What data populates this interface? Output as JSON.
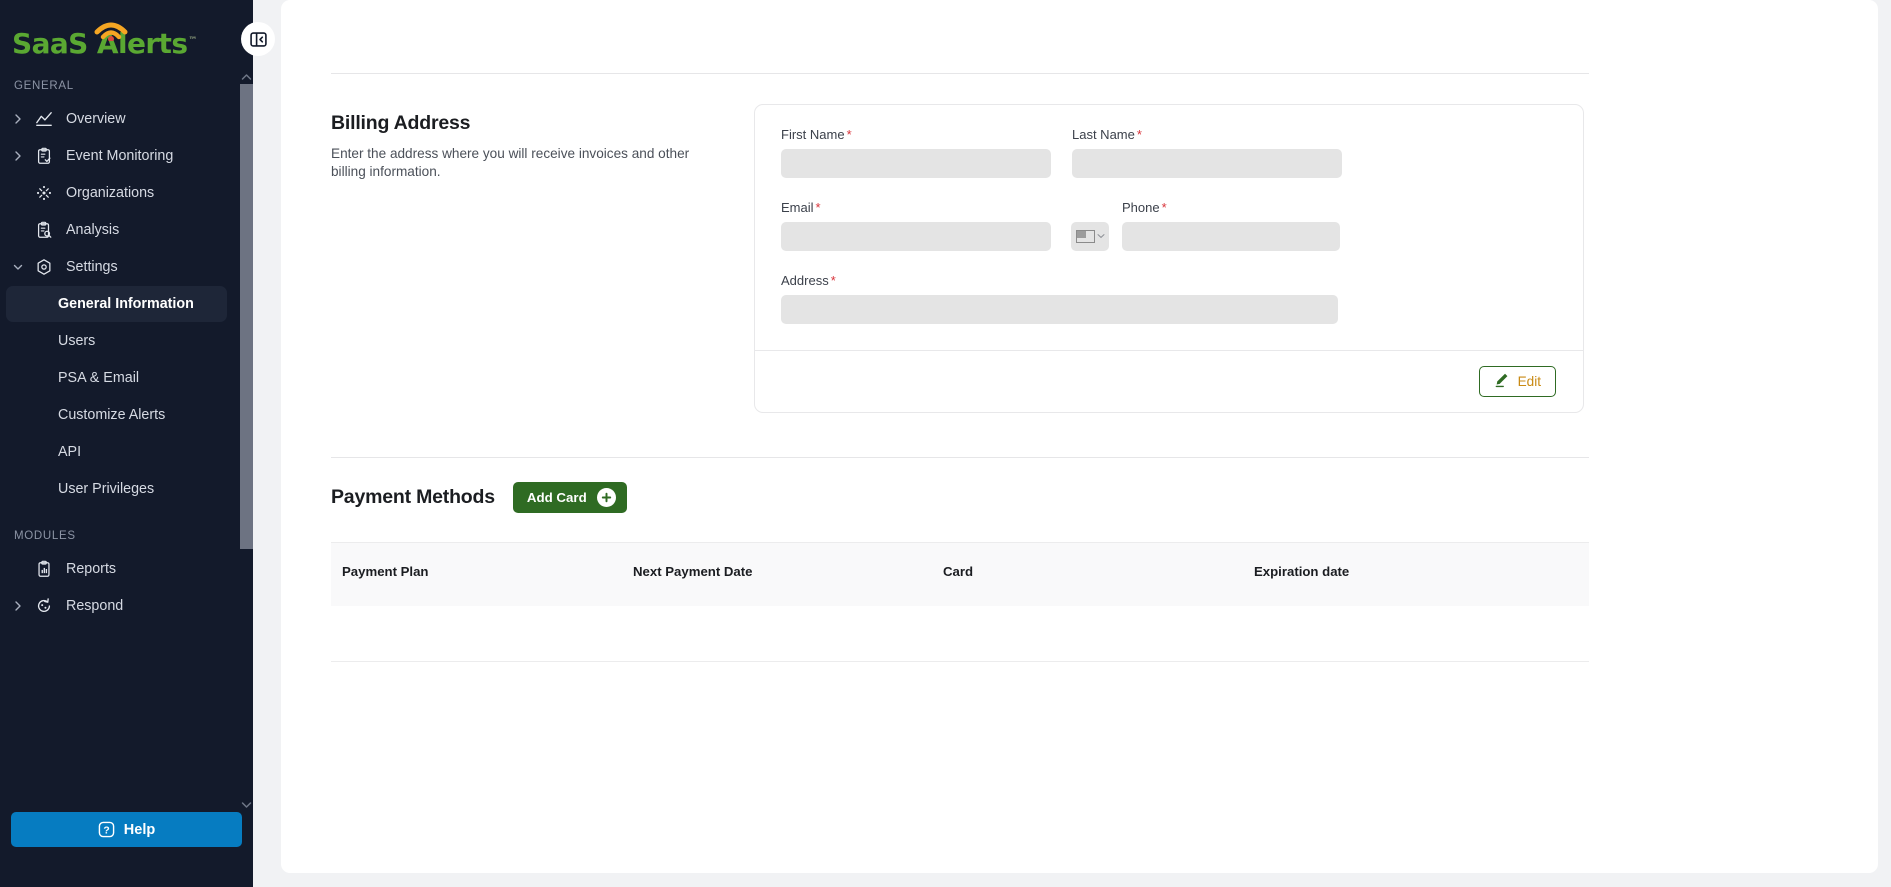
{
  "brand": {
    "name_part1": "SaaS",
    "name_part2": "Alerts",
    "trademark": "™"
  },
  "sidebar": {
    "sections": [
      {
        "label": "GENERAL"
      },
      {
        "label": "MODULES"
      }
    ],
    "general_items": [
      {
        "label": "Overview",
        "icon": "chart-line-icon",
        "chevron": true,
        "sub": false
      },
      {
        "label": "Event Monitoring",
        "icon": "clipboard-check-icon",
        "chevron": true,
        "sub": false
      },
      {
        "label": "Organizations",
        "icon": "organizations-icon",
        "chevron": false,
        "sub": false
      },
      {
        "label": "Analysis",
        "icon": "clipboard-search-icon",
        "chevron": false,
        "sub": false
      },
      {
        "label": "Settings",
        "icon": "settings-hex-icon",
        "chevron": true,
        "expanded": true,
        "sub": false
      }
    ],
    "settings_children": [
      {
        "label": "General Information",
        "active": true
      },
      {
        "label": "Users",
        "active": false
      },
      {
        "label": "PSA & Email",
        "active": false
      },
      {
        "label": "Customize Alerts",
        "active": false
      },
      {
        "label": "API",
        "active": false
      },
      {
        "label": "User Privileges",
        "active": false
      }
    ],
    "modules_items": [
      {
        "label": "Reports",
        "icon": "reports-icon",
        "chevron": false
      },
      {
        "label": "Respond",
        "icon": "respond-refresh-icon",
        "chevron": true
      }
    ],
    "help_label": "Help",
    "collapse_icon": "panel-collapse-left-icon"
  },
  "billing": {
    "title": "Billing Address",
    "description": "Enter the address where you will receive invoices and other billing information.",
    "fields": {
      "first_name": {
        "label": "First Name",
        "required": "*",
        "value": "",
        "placeholder": ""
      },
      "last_name": {
        "label": "Last Name",
        "required": "*",
        "value": "",
        "placeholder": ""
      },
      "email": {
        "label": "Email",
        "required": "*",
        "value": "",
        "placeholder": ""
      },
      "phone": {
        "label": "Phone",
        "required": "*",
        "value": "",
        "placeholder": ""
      },
      "address": {
        "label": "Address",
        "required": "*",
        "value": "",
        "placeholder": ""
      }
    },
    "country_select": {
      "icon": "us-flag-icon",
      "caret": "chevron-down-icon"
    },
    "edit_button": {
      "label": "Edit",
      "icon": "pencil-icon",
      "border_color": "#2f6b23",
      "text_color": "#c98a14"
    }
  },
  "payment_methods": {
    "title": "Payment Methods",
    "add_card_button": {
      "label": "Add Card",
      "icon": "plus-circle-icon",
      "bg_color": "#2f6b23"
    },
    "table": {
      "columns": [
        "Payment Plan",
        "Next Payment Date",
        "Card",
        "Expiration date"
      ],
      "rows": []
    }
  },
  "colors": {
    "sidebar_bg": "#131a2b",
    "brand_green": "#5aa832",
    "brand_orange": "#f5a623",
    "help_blue": "#067cc1",
    "required_red": "#d8333a",
    "page_bg": "#f1f2f4"
  }
}
